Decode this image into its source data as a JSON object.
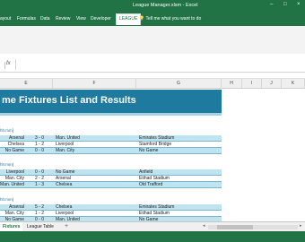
{
  "app": {
    "document_title": "League Manager.xlsm - Excel"
  },
  "ribbon": {
    "tabs": [
      "ayout",
      "Formulas",
      "Data",
      "Review",
      "View",
      "Developer",
      "LEAGUE"
    ],
    "active_tab": "LEAGUE",
    "tell_me": "Tell me what you want to do"
  },
  "formula_bar": {
    "fx": "fx",
    "content": ""
  },
  "columns": [
    "E",
    "F",
    "G",
    "H",
    "I",
    "J",
    "K"
  ],
  "sheet_title": "me Fixtures List and Results",
  "groups": [
    {
      "hint": "hh:mm]",
      "rows": [
        {
          "home": "Arsenal",
          "score": "3 - 0",
          "away": "Man. United",
          "venue": "Emirates Stadium",
          "style": "blue"
        },
        {
          "home": "Chelsea",
          "score": "1 - 2",
          "away": "Liverpool",
          "venue": "Stamford Bridge",
          "style": "white"
        },
        {
          "home": "No Game",
          "score": "0 - 0",
          "away": "Man. City",
          "venue": "No Game",
          "style": "blue"
        }
      ]
    },
    {
      "hint": "hh:mm]",
      "rows": [
        {
          "home": "Liverpool",
          "score": "0 - 0",
          "away": "No Game",
          "venue": "Anfield",
          "style": "blue"
        },
        {
          "home": "Man. City",
          "score": "2 - 2",
          "away": "Arsenal",
          "venue": "Etihad Stadium",
          "style": "white"
        },
        {
          "home": "Man. United",
          "score": "1 - 3",
          "away": "Chelsea",
          "venue": "Old Trafford",
          "style": "blue"
        }
      ]
    },
    {
      "hint": "hh:mm]",
      "rows": [
        {
          "home": "Arsenal",
          "score": "5 - 2",
          "away": "Chelsea",
          "venue": "Emirates Stadium",
          "style": "blue"
        },
        {
          "home": "Man. City",
          "score": "1 - 2",
          "away": "Liverpool",
          "venue": "Etihad Stadium",
          "style": "white"
        },
        {
          "home": "No Game",
          "score": "0 - 0",
          "away": "Man. United",
          "venue": "No Game",
          "style": "blue"
        }
      ]
    }
  ],
  "sheet_tabs": [
    {
      "label": "Fixtures",
      "active": true
    },
    {
      "label": "League Table",
      "active": false
    }
  ],
  "sheet_nav": {
    "add": "+"
  },
  "colors": {
    "excel_green": "#217346",
    "banner": "#1e7a9e",
    "row_blue": "#bfe3ef"
  }
}
